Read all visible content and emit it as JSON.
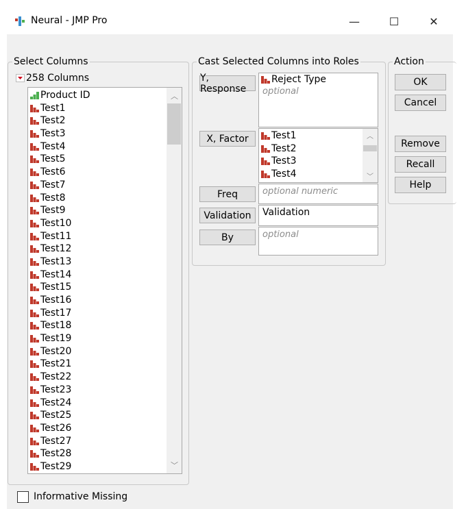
{
  "window": {
    "title": "Neural - JMP Pro",
    "minimize": "—",
    "maximize": "☐",
    "close": "✕"
  },
  "select_columns": {
    "label": "Select Columns",
    "count_label": "258 Columns",
    "columns": [
      {
        "name": "Product ID",
        "type": "ordinal"
      },
      {
        "name": "Test1"
      },
      {
        "name": "Test2"
      },
      {
        "name": "Test3"
      },
      {
        "name": "Test4"
      },
      {
        "name": "Test5"
      },
      {
        "name": "Test6"
      },
      {
        "name": "Test7"
      },
      {
        "name": "Test8"
      },
      {
        "name": "Test9"
      },
      {
        "name": "Test10"
      },
      {
        "name": "Test11"
      },
      {
        "name": "Test12"
      },
      {
        "name": "Test13"
      },
      {
        "name": "Test14"
      },
      {
        "name": "Test15"
      },
      {
        "name": "Test16"
      },
      {
        "name": "Test17"
      },
      {
        "name": "Test18"
      },
      {
        "name": "Test19"
      },
      {
        "name": "Test20"
      },
      {
        "name": "Test21"
      },
      {
        "name": "Test22"
      },
      {
        "name": "Test23"
      },
      {
        "name": "Test24"
      },
      {
        "name": "Test25"
      },
      {
        "name": "Test26"
      },
      {
        "name": "Test27"
      },
      {
        "name": "Test28"
      },
      {
        "name": "Test29"
      }
    ]
  },
  "roles": {
    "label": "Cast Selected Columns into Roles",
    "y": {
      "button": "Y, Response",
      "values": [
        "Reject Type"
      ],
      "placeholder": "optional"
    },
    "x": {
      "button": "X, Factor",
      "values": [
        "Test1",
        "Test2",
        "Test3",
        "Test4"
      ]
    },
    "freq": {
      "button": "Freq",
      "placeholder": "optional numeric"
    },
    "validation": {
      "button": "Validation",
      "value": "Validation"
    },
    "by": {
      "button": "By",
      "placeholder": "optional"
    }
  },
  "action": {
    "label": "Action",
    "ok": "OK",
    "cancel": "Cancel",
    "remove": "Remove",
    "recall": "Recall",
    "help": "Help"
  },
  "informative_missing": {
    "label": "Informative Missing",
    "checked": false
  },
  "colors": {
    "nominal_icon": "#c0392b",
    "ordinal_icon": "#4caf50",
    "disclosure": "#d0021b"
  }
}
